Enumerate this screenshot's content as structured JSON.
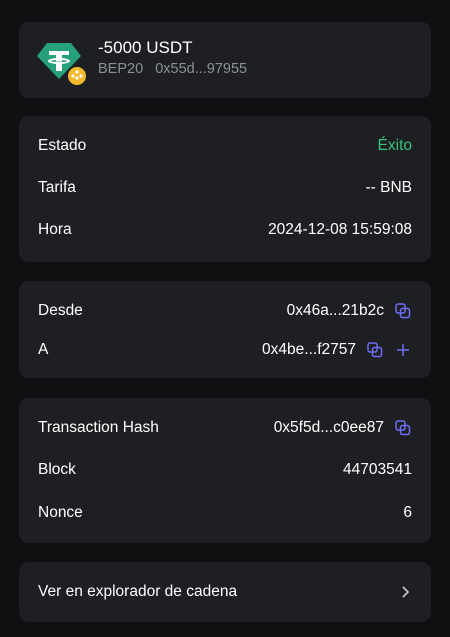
{
  "header": {
    "amount": "-5000 USDT",
    "network": "BEP20",
    "address": "0x55d...97955",
    "colors": {
      "tether": "#26a17b",
      "bnb": "#f3ba2f"
    }
  },
  "details": {
    "status_label": "Estado",
    "status_value": "Éxito",
    "fee_label": "Tarifa",
    "fee_value": "-- BNB",
    "time_label": "Hora",
    "time_value": "2024-12-08 15:59:08"
  },
  "addresses": {
    "from_label": "Desde",
    "from_value": "0x46a...21b2c",
    "to_label": "A",
    "to_value": "0x4be...f2757"
  },
  "tx": {
    "hash_label": "Transaction Hash",
    "hash_value": "0x5f5d...c0ee87",
    "block_label": "Block",
    "block_value": "44703541",
    "nonce_label": "Nonce",
    "nonce_value": "6"
  },
  "explorer": {
    "label": "Ver en explorador de cadena"
  },
  "colors": {
    "success": "#37c47b",
    "accent": "#6c6ef5",
    "card": "#1d1f22",
    "background": "#0f1012"
  }
}
